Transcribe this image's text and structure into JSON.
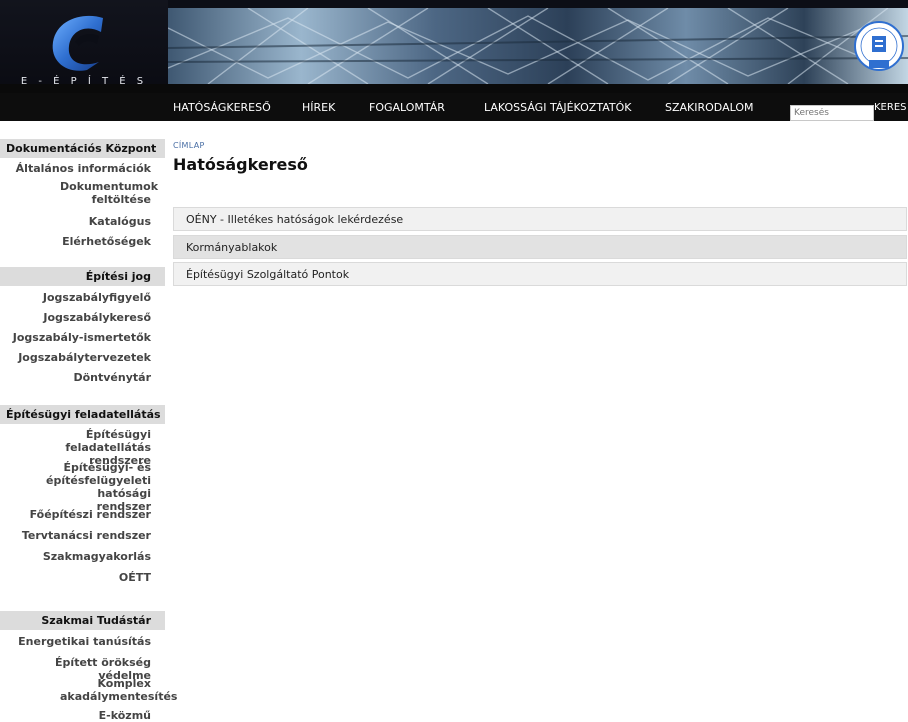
{
  "header": {
    "logo_text": "E - É P Í T É S"
  },
  "nav": {
    "items": [
      {
        "label": "HATÓSÁGKERESŐ"
      },
      {
        "label": "HÍREK"
      },
      {
        "label": "FOGALOMTÁR"
      },
      {
        "label": "LAKOSSÁGI TÁJÉKOZTATÓK"
      },
      {
        "label": "SZAKIRODALOM"
      }
    ],
    "search_placeholder": "Keresés",
    "search_button": "KERES"
  },
  "sidebar": {
    "sections": [
      {
        "title": "Dokumentációs Központ",
        "items": [
          {
            "label": "Általános információk"
          },
          {
            "label": "Dokumentumok feltöltése"
          },
          {
            "label": "Katalógus"
          },
          {
            "label": "Elérhetőségek"
          }
        ]
      },
      {
        "title": "Építési jog",
        "items": [
          {
            "label": "Jogszabályfigyelő"
          },
          {
            "label": "Jogszabálykereső"
          },
          {
            "label": "Jogszabály-ismertetők"
          },
          {
            "label": "Jogszabálytervezetek"
          },
          {
            "label": "Döntvénytár"
          }
        ]
      },
      {
        "title": "Építésügyi feladatellátás",
        "items": [
          {
            "label": "Építésügyi feladatellátás rendszere"
          },
          {
            "label": "Építésügyi- és építésfelügyeleti hatósági rendszer"
          },
          {
            "label": "Főépítészi rendszer"
          },
          {
            "label": "Tervtanácsi rendszer"
          },
          {
            "label": "Szakmagyakorlás"
          },
          {
            "label": "OÉTT"
          }
        ]
      },
      {
        "title": "Szakmai Tudástár",
        "items": [
          {
            "label": "Energetikai tanúsítás"
          },
          {
            "label": "Épített örökség védelme"
          },
          {
            "label": "Komplex akadálymentesítés"
          },
          {
            "label": "E-közmű"
          }
        ]
      }
    ]
  },
  "main": {
    "breadcrumb": "CÍMLAP",
    "title": "Hatóságkereső",
    "rows": [
      {
        "label": "OÉNY - Illetékes hatóságok lekérdezése",
        "bg": "#f1f1f1"
      },
      {
        "label": "Kormányablakok",
        "bg": "#e2e2e2"
      },
      {
        "label": "Építésügyi Szolgáltató Pontok",
        "bg": "#f1f1f1"
      }
    ]
  },
  "colors": {
    "accent_blue": "#2f6fd0",
    "breadcrumb": "#4a6fa5",
    "sidebar_header_bg": "#dcdcdc",
    "nav_bg": "#0d0d0d"
  }
}
